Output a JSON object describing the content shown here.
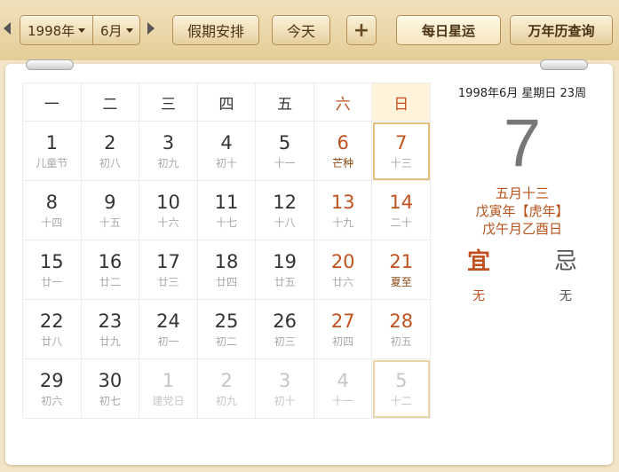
{
  "toolbar": {
    "year": "1998年",
    "month": "6月",
    "holiday_label": "假期安排",
    "today_label": "今天",
    "plus_label": "+",
    "tab_daily": "每日星运",
    "tab_almanac": "万年历查询"
  },
  "weekdays": [
    "一",
    "二",
    "三",
    "四",
    "五",
    "六",
    "日"
  ],
  "weeks": [
    [
      {
        "num": "1",
        "lunar": "儿童节",
        "type": "normal"
      },
      {
        "num": "2",
        "lunar": "初八",
        "type": "normal"
      },
      {
        "num": "3",
        "lunar": "初九",
        "type": "normal"
      },
      {
        "num": "4",
        "lunar": "初十",
        "type": "normal"
      },
      {
        "num": "5",
        "lunar": "十一",
        "type": "normal"
      },
      {
        "num": "6",
        "lunar": "芒种",
        "type": "weekend-term"
      },
      {
        "num": "7",
        "lunar": "十三",
        "type": "today"
      }
    ],
    [
      {
        "num": "8",
        "lunar": "十四",
        "type": "normal"
      },
      {
        "num": "9",
        "lunar": "十五",
        "type": "normal"
      },
      {
        "num": "10",
        "lunar": "十六",
        "type": "normal"
      },
      {
        "num": "11",
        "lunar": "十七",
        "type": "normal"
      },
      {
        "num": "12",
        "lunar": "十八",
        "type": "normal"
      },
      {
        "num": "13",
        "lunar": "十九",
        "type": "weekend"
      },
      {
        "num": "14",
        "lunar": "二十",
        "type": "weekend"
      }
    ],
    [
      {
        "num": "15",
        "lunar": "廿一",
        "type": "normal"
      },
      {
        "num": "16",
        "lunar": "廿二",
        "type": "normal"
      },
      {
        "num": "17",
        "lunar": "廿三",
        "type": "normal"
      },
      {
        "num": "18",
        "lunar": "廿四",
        "type": "normal"
      },
      {
        "num": "19",
        "lunar": "廿五",
        "type": "normal"
      },
      {
        "num": "20",
        "lunar": "廿六",
        "type": "weekend"
      },
      {
        "num": "21",
        "lunar": "夏至",
        "type": "weekend-term"
      }
    ],
    [
      {
        "num": "22",
        "lunar": "廿八",
        "type": "normal"
      },
      {
        "num": "23",
        "lunar": "廿九",
        "type": "normal"
      },
      {
        "num": "24",
        "lunar": "初一",
        "type": "normal"
      },
      {
        "num": "25",
        "lunar": "初二",
        "type": "normal"
      },
      {
        "num": "26",
        "lunar": "初三",
        "type": "normal"
      },
      {
        "num": "27",
        "lunar": "初四",
        "type": "weekend"
      },
      {
        "num": "28",
        "lunar": "初五",
        "type": "weekend"
      }
    ],
    [
      {
        "num": "29",
        "lunar": "初六",
        "type": "normal"
      },
      {
        "num": "30",
        "lunar": "初七",
        "type": "normal"
      },
      {
        "num": "1",
        "lunar": "建党日",
        "type": "other"
      },
      {
        "num": "2",
        "lunar": "初九",
        "type": "other"
      },
      {
        "num": "3",
        "lunar": "初十",
        "type": "other"
      },
      {
        "num": "4",
        "lunar": "十一",
        "type": "other"
      },
      {
        "num": "5",
        "lunar": "十二",
        "type": "other-highlight"
      }
    ]
  ],
  "info": {
    "date_line": "1998年6月 星期日 23周",
    "big_day": "7",
    "lunar_date": "五月十三",
    "year_ganzhi": "戊寅年【虎年】",
    "month_day_ganzhi": "戊午月乙酉日",
    "yi_label": "宜",
    "ji_label": "忌",
    "yi_value": "无",
    "ji_value": "无"
  },
  "colors": {
    "weekend": "#c0521f",
    "accent_border": "#e2c27a"
  }
}
